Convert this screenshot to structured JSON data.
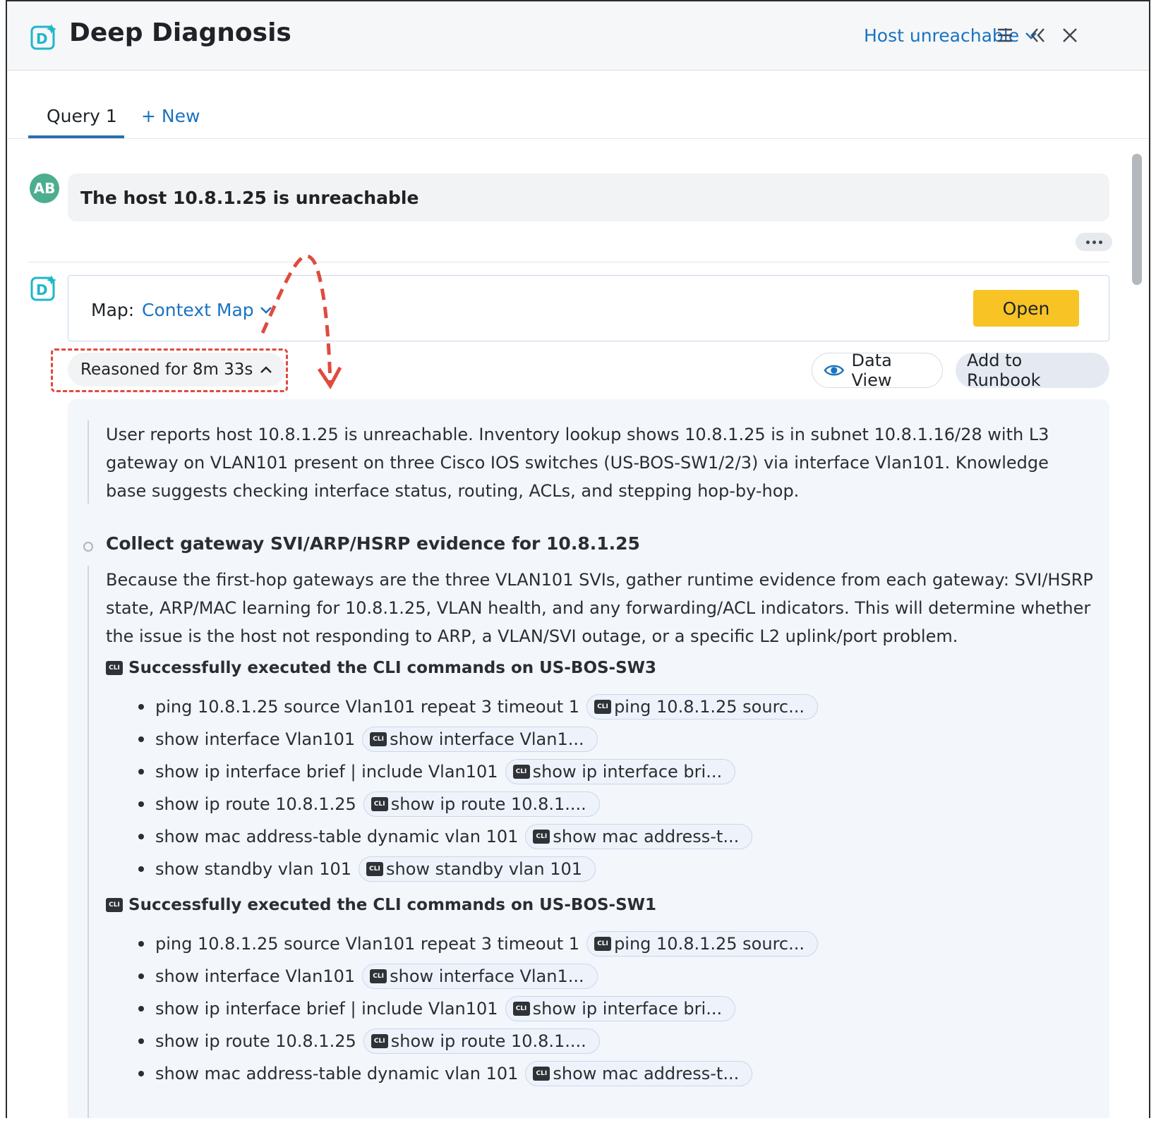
{
  "header": {
    "title": "Deep Diagnosis",
    "issue_selector": "Host unreachable"
  },
  "tabs": {
    "active": "Query 1",
    "new": "+ New"
  },
  "query": {
    "avatar": "AB",
    "text": "The host 10.8.1.25 is unreachable"
  },
  "map": {
    "label": "Map:",
    "value": "Context Map",
    "open_label": "Open"
  },
  "reasoning": {
    "label": "Reasoned for 8m 33s",
    "data_view": "Data View",
    "add_to_runbook": "Add to Runbook",
    "summary": "User reports host 10.8.1.25 is unreachable. Inventory lookup shows 10.8.1.25 is in subnet 10.8.1.16/28 with L3 gateway on VLAN101 present on three Cisco IOS switches (US-BOS-SW1/2/3) via interface Vlan101. Knowledge base suggests checking interface status, routing, ACLs, and stepping hop-by-hop.",
    "step_title": "Collect gateway SVI/ARP/HSRP evidence for 10.8.1.25",
    "step_desc": "Because the first-hop gateways are the three VLAN101 SVIs, gather runtime evidence from each gateway: SVI/HSRP state, ARP/MAC learning for 10.8.1.25, VLAN health, and any forwarding/ACL indicators. This will determine whether the issue is the host not responding to ARP, a VLAN/SVI outage, or a specific L2 uplink/port problem.",
    "cli_icon_text": "CLI",
    "groups": [
      {
        "heading": "Successfully executed the CLI commands on US-BOS-SW3",
        "commands": [
          {
            "cmd": "ping 10.8.1.25 source Vlan101 repeat 3 timeout 1",
            "chip": "ping 10.8.1.25 sourc..."
          },
          {
            "cmd": "show interface Vlan101",
            "chip": "show interface Vlan1..."
          },
          {
            "cmd": "show ip interface brief | include Vlan101",
            "chip": "show ip interface bri..."
          },
          {
            "cmd": "show ip route 10.8.1.25",
            "chip": "show ip route 10.8.1...."
          },
          {
            "cmd": "show mac address-table dynamic vlan 101",
            "chip": "show mac address-t..."
          },
          {
            "cmd": "show standby vlan 101",
            "chip": "show standby vlan 101"
          }
        ]
      },
      {
        "heading": "Successfully executed the CLI commands on US-BOS-SW1",
        "commands": [
          {
            "cmd": "ping 10.8.1.25 source Vlan101 repeat 3 timeout 1",
            "chip": "ping 10.8.1.25 sourc..."
          },
          {
            "cmd": "show interface Vlan101",
            "chip": "show interface Vlan1..."
          },
          {
            "cmd": "show ip interface brief | include Vlan101",
            "chip": "show ip interface bri..."
          },
          {
            "cmd": "show ip route 10.8.1.25",
            "chip": "show ip route 10.8.1...."
          },
          {
            "cmd": "show mac address-table dynamic vlan 101",
            "chip": "show mac address-t..."
          }
        ]
      }
    ]
  },
  "colors": {
    "accent": "#1a73c0",
    "open_button": "#f7c325",
    "annotation": "#e04a3f",
    "logo": "#1fb7c9"
  }
}
